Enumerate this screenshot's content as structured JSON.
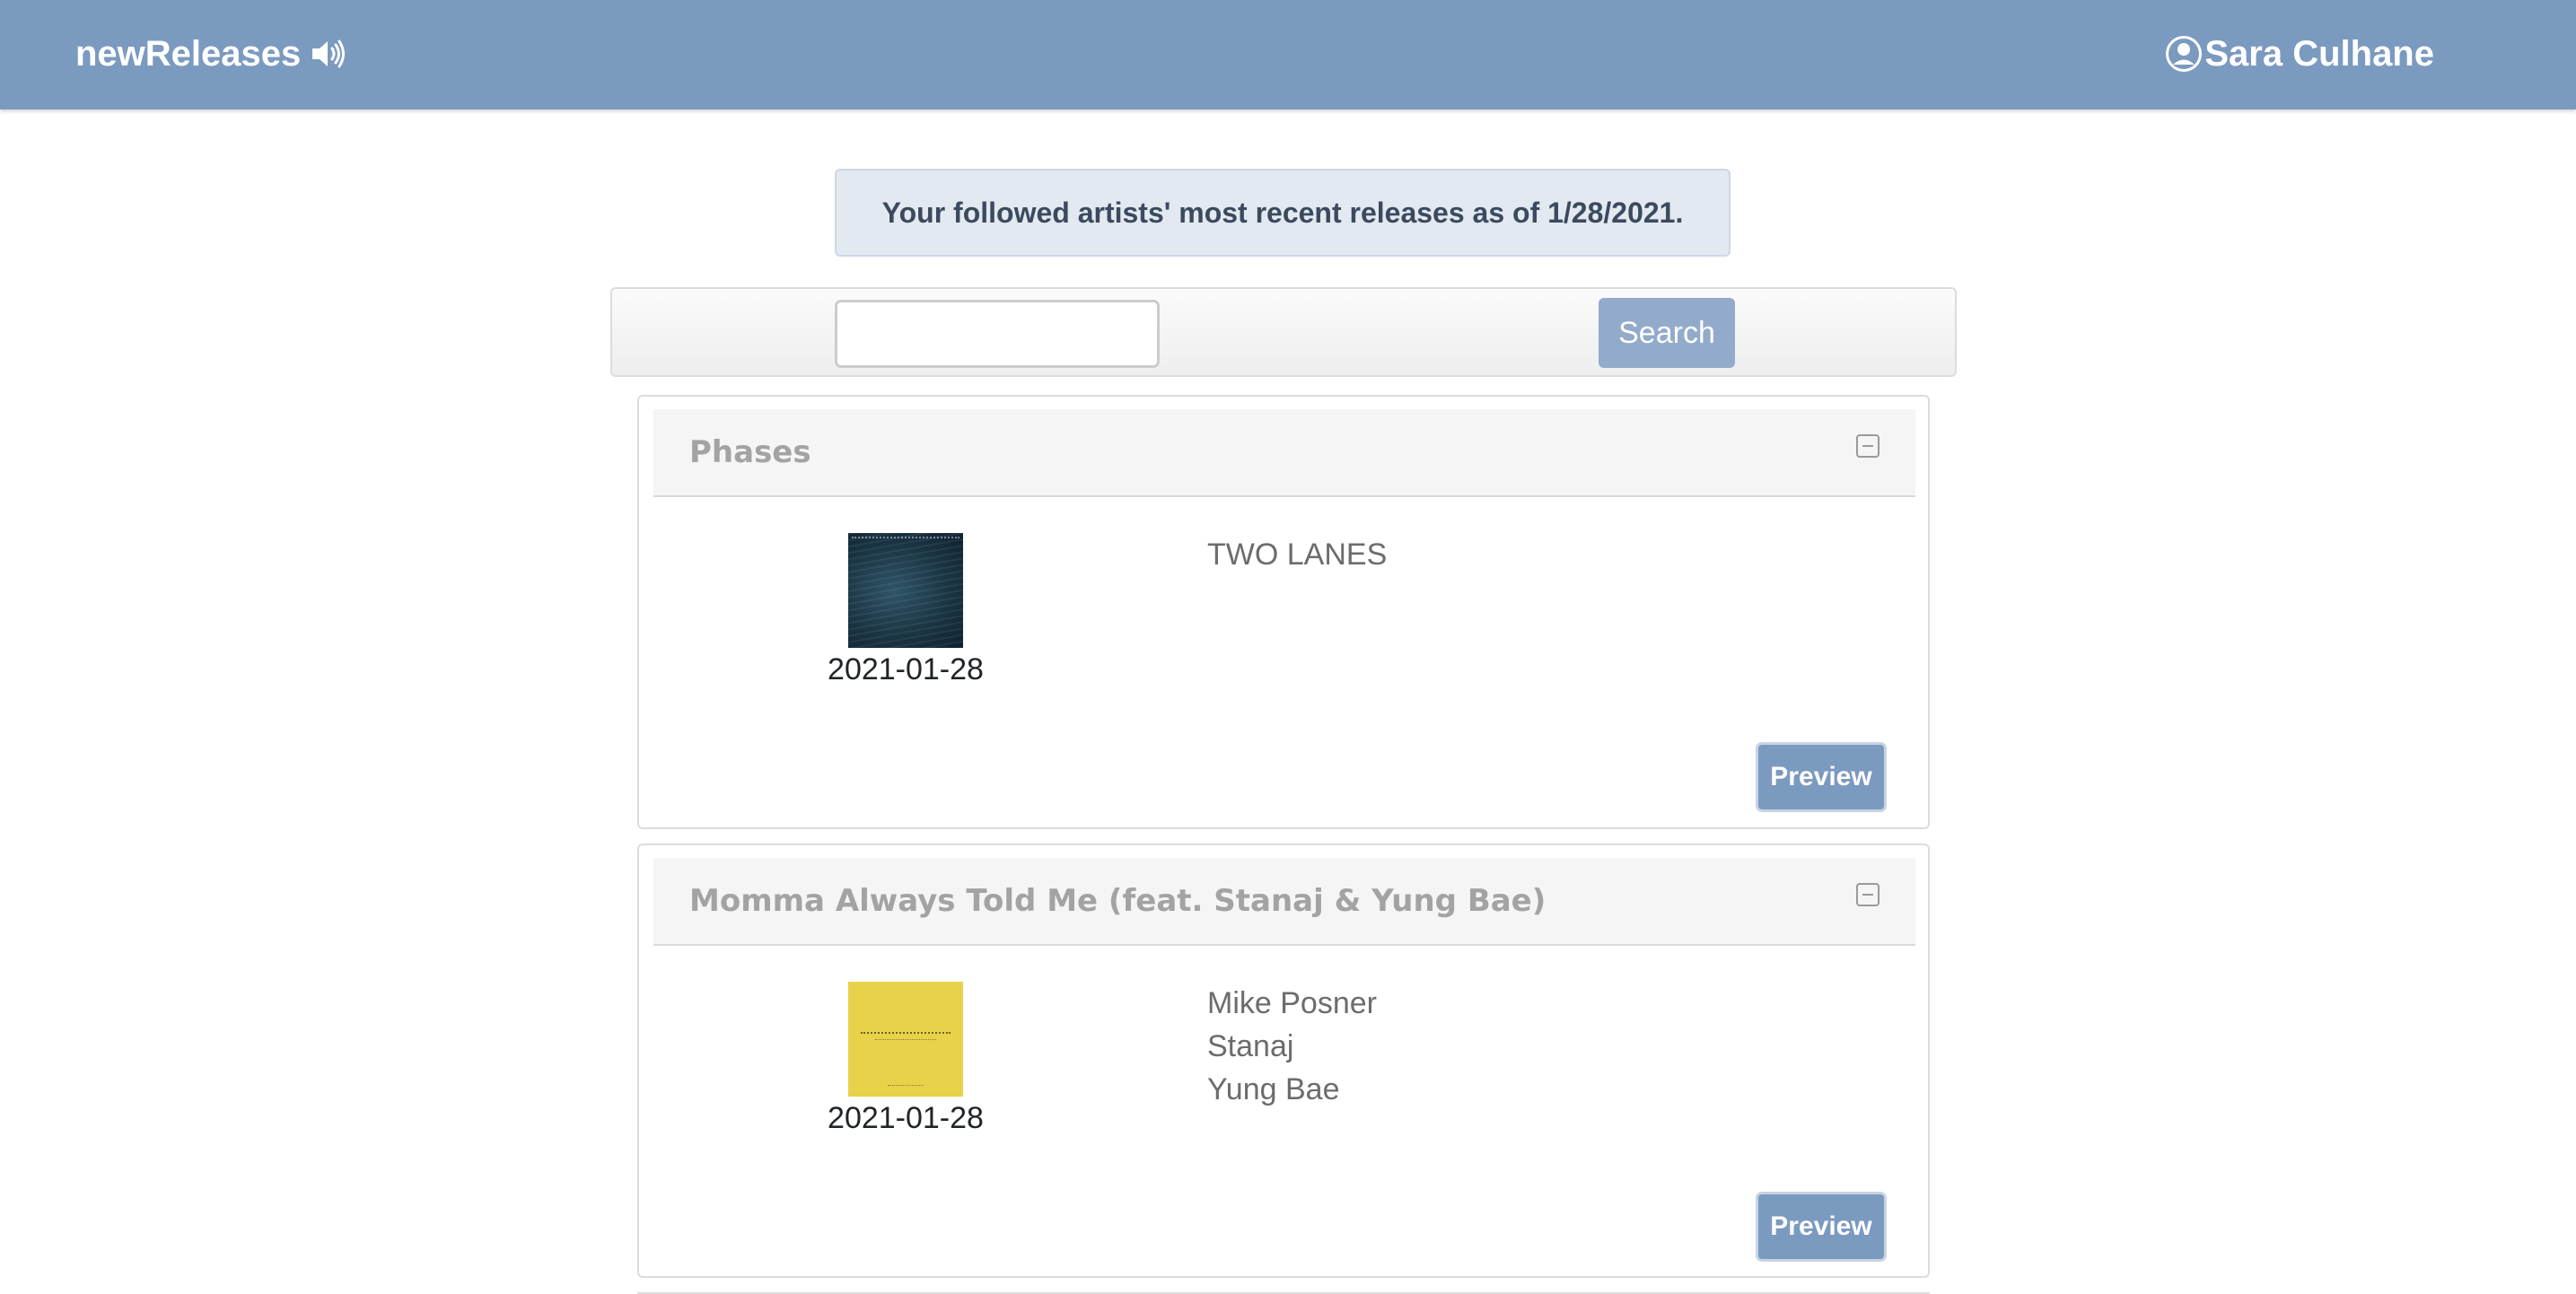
{
  "navbar": {
    "brand": "newReleases",
    "brand_icon": "speaker-volume-icon",
    "user_icon": "user-circle-icon",
    "user_name": "Sara Culhane"
  },
  "alert": {
    "text": "Your followed artists' most recent releases as of 1/28/2021."
  },
  "search": {
    "value": "",
    "placeholder": "",
    "button_label": "Search"
  },
  "releases": [
    {
      "title": "Phases",
      "date": "2021-01-28",
      "artists": [
        "TWO LANES"
      ],
      "preview_label": "Preview"
    },
    {
      "title": "Momma Always Told Me (feat. Stanaj & Yung Bae)",
      "date": "2021-01-28",
      "artists": [
        "Mike Posner",
        "Stanaj",
        "Yung Bae"
      ],
      "preview_label": "Preview"
    }
  ],
  "colors": {
    "navbar": "#7b9abf",
    "alert_bg": "#e3e9f1",
    "search_button": "#93abcb",
    "preview_button": "#7b9abf"
  }
}
